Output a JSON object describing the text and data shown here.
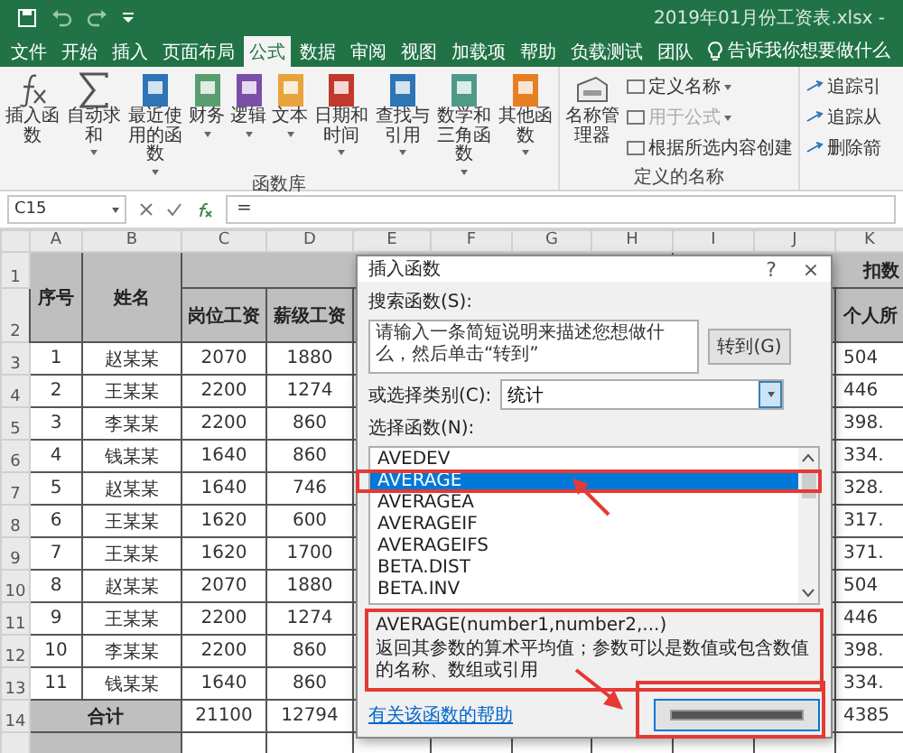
{
  "title_bar": {
    "title": "2019年01月份工资表.xlsx -"
  },
  "tabs": [
    {
      "label": "文件",
      "selected": false
    },
    {
      "label": "开始",
      "selected": false
    },
    {
      "label": "插入",
      "selected": false
    },
    {
      "label": "页面布局",
      "selected": false
    },
    {
      "label": "公式",
      "selected": true
    },
    {
      "label": "数据",
      "selected": false
    },
    {
      "label": "审阅",
      "selected": false
    },
    {
      "label": "视图",
      "selected": false
    },
    {
      "label": "加载项",
      "selected": false
    },
    {
      "label": "帮助",
      "selected": false
    },
    {
      "label": "负载测试",
      "selected": false
    },
    {
      "label": "团队",
      "selected": false
    }
  ],
  "tell_me": {
    "placeholder": "告诉我你想要做什么"
  },
  "ribbon": {
    "function_library": {
      "label": "函数库",
      "buttons": [
        {
          "label": "插入函数",
          "kind": "fx",
          "dropdown": false
        },
        {
          "label": "自动求和",
          "kind": "sum",
          "dropdown": true
        },
        {
          "label": "最近使用的函数",
          "kind": "book",
          "color": "#2e75b6",
          "dropdown": true
        },
        {
          "label": "财务",
          "kind": "book",
          "color": "#5a9e6f",
          "dropdown": true
        },
        {
          "label": "逻辑",
          "kind": "book",
          "color": "#7b4fa8",
          "dropdown": true
        },
        {
          "label": "文本",
          "kind": "book",
          "color": "#e8a33c",
          "dropdown": true
        },
        {
          "label": "日期和时间",
          "kind": "book",
          "color": "#c0392b",
          "dropdown": true
        },
        {
          "label": "查找与引用",
          "kind": "book",
          "color": "#2e75b6",
          "dropdown": true
        },
        {
          "label": "数学和三角函数",
          "kind": "book",
          "color": "#4f9a86",
          "dropdown": true
        },
        {
          "label": "其他函数",
          "kind": "book",
          "color": "#e67e22",
          "dropdown": true
        }
      ]
    },
    "defined_names": {
      "label": "定义的名称",
      "manager": "名称管理器",
      "items": [
        {
          "label": "定义名称",
          "dropdown": true,
          "disabled": false
        },
        {
          "label": "用于公式",
          "dropdown": true,
          "disabled": true
        },
        {
          "label": "根据所选内容创建",
          "dropdown": false,
          "disabled": false
        }
      ]
    },
    "auditing": {
      "items": [
        {
          "label": "追踪引"
        },
        {
          "label": "追踪从"
        },
        {
          "label": "删除箭"
        }
      ]
    }
  },
  "formula_bar": {
    "name_box": "C15",
    "formula": "="
  },
  "columns": [
    "A",
    "B",
    "C",
    "D",
    "E",
    "F",
    "G",
    "H",
    "I",
    "J",
    "K"
  ],
  "sheet": {
    "header_rows": [
      "1",
      "2"
    ],
    "seq": "序号",
    "name": "姓名",
    "col_c": "岗位工资",
    "col_d": "薪级工资",
    "deduct": "扣数",
    "col_k": "个人所",
    "rows": [
      {
        "row": "3",
        "seq": "1",
        "name": "赵某某",
        "c": "2070",
        "d": "1880",
        "k": "504"
      },
      {
        "row": "4",
        "seq": "2",
        "name": "王某某",
        "c": "2200",
        "d": "1274",
        "k": "446"
      },
      {
        "row": "5",
        "seq": "3",
        "name": "李某某",
        "c": "2200",
        "d": "860",
        "k": "398."
      },
      {
        "row": "6",
        "seq": "4",
        "name": "钱某某",
        "c": "1640",
        "d": "860",
        "k": "334."
      },
      {
        "row": "7",
        "seq": "5",
        "name": "赵某某",
        "c": "1640",
        "d": "746",
        "k": "328."
      },
      {
        "row": "8",
        "seq": "6",
        "name": "王某某",
        "c": "1620",
        "d": "600",
        "k": "317."
      },
      {
        "row": "9",
        "seq": "7",
        "name": "王某某",
        "c": "1620",
        "d": "1700",
        "k": "371."
      },
      {
        "row": "10",
        "seq": "8",
        "name": "赵某某",
        "c": "2070",
        "d": "1880",
        "k": "504"
      },
      {
        "row": "11",
        "seq": "9",
        "name": "王某某",
        "c": "2200",
        "d": "1274",
        "k": "446"
      },
      {
        "row": "12",
        "seq": "10",
        "name": "李某某",
        "c": "2200",
        "d": "860",
        "k": "398."
      },
      {
        "row": "13",
        "seq": "11",
        "name": "钱某某",
        "c": "1640",
        "d": "860",
        "k": "334."
      }
    ],
    "total": {
      "row": "14",
      "label": "合计",
      "c": "21100",
      "d": "12794",
      "k": "4385"
    }
  },
  "dialog": {
    "title": "插入函数",
    "help": "?",
    "close": "×",
    "search_label": "搜索函数(S):",
    "search_value": "请输入一条简短说明来描述您想做什么，然后单击“转到”",
    "go_button": "转到(G)",
    "category_label": "或选择类别(C):",
    "category_value": "统计",
    "list_label": "选择函数(N):",
    "functions": [
      {
        "name": "AVEDEV",
        "selected": false
      },
      {
        "name": "AVERAGE",
        "selected": true
      },
      {
        "name": "AVERAGEA",
        "selected": false
      },
      {
        "name": "AVERAGEIF",
        "selected": false
      },
      {
        "name": "AVERAGEIFS",
        "selected": false
      },
      {
        "name": "BETA.DIST",
        "selected": false
      },
      {
        "name": "BETA.INV",
        "selected": false
      }
    ],
    "signature": "AVERAGE(number1,number2,...)",
    "description": "返回其参数的算术平均值；参数可以是数值或包含数值的名称、数组或引用",
    "help_link": "有关该函数的帮助"
  }
}
